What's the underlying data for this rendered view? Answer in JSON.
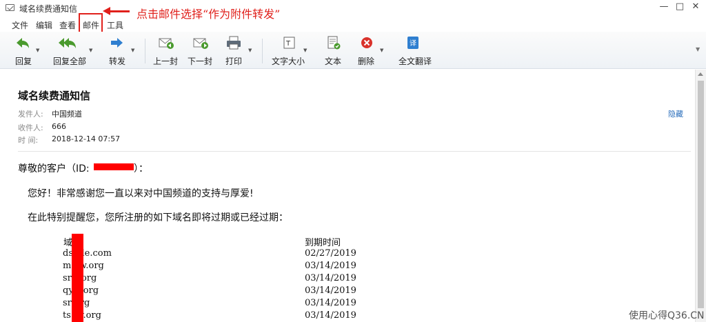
{
  "window": {
    "title": "域名续费通知信",
    "min": "—",
    "max": "□",
    "close": "✕"
  },
  "menu": [
    "文件",
    "编辑",
    "查看",
    "邮件",
    "工具"
  ],
  "annotation": "点击邮件选择“作为附件转发”",
  "toolbar": {
    "reply": "回复",
    "reply_all": "回复全部",
    "forward": "转发",
    "prev": "上一封",
    "next": "下一封",
    "print": "打印",
    "font_size": "文字大小",
    "text": "文本",
    "delete": "删除",
    "translate": "全文翻译"
  },
  "email": {
    "subject": "域名续费通知信",
    "from_label": "发件人:",
    "from": "中国频道",
    "to_label": "收件人:",
    "to": "666",
    "time_label": "时   间:",
    "time": "2018-12-14  07:57",
    "hide": "隐藏",
    "greeting_pre": "尊敬的客户（ID:",
    "greeting_post": "）：",
    "line1": "您好！非常感谢您一直以来对中国频道的支持与厚爱!",
    "line2": "在此特别提醒您，您所注册的如下域名即将过期或已经过期：",
    "table_header_domain": "域",
    "table_header_expiry": "到期时间",
    "rows": [
      {
        "domain": "ds        nle.com",
        "expiry": "02/27/2019"
      },
      {
        "domain": "m        xw.org",
        "expiry": "03/14/2019"
      },
      {
        "domain": "sr      v.org",
        "expiry": "03/14/2019"
      },
      {
        "domain": "qy      v.org",
        "expiry": "03/14/2019"
      },
      {
        "domain": "sr      org",
        "expiry": "03/14/2019"
      },
      {
        "domain": "ts      oy.org",
        "expiry": "03/14/2019"
      }
    ]
  },
  "watermark": "使用心得Q36.CN",
  "colors": {
    "accent": "#e0201b",
    "link": "#2a6ebb"
  }
}
